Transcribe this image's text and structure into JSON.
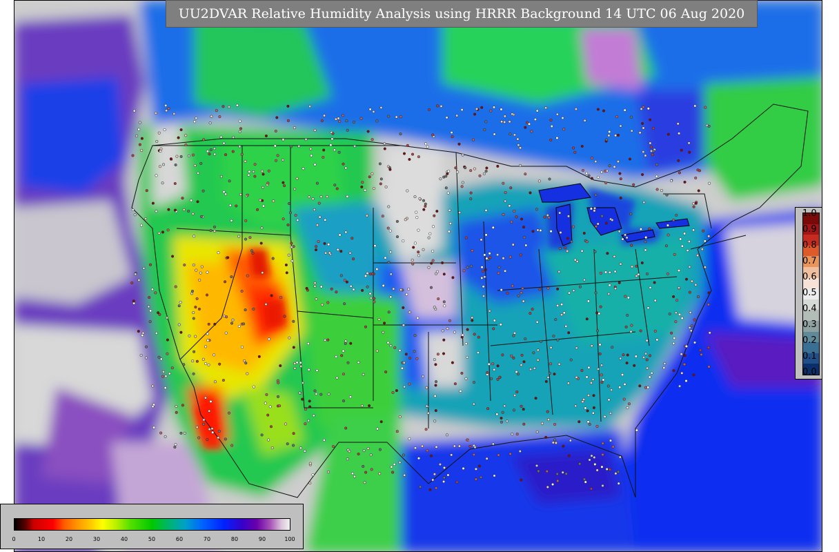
{
  "title": "UU2DVAR Relative Humidity Analysis using HRRR Background 14 UTC 06 Aug 2020",
  "rh_colorbar": {
    "ticks": [
      "0",
      "10",
      "20",
      "30",
      "40",
      "50",
      "60",
      "70",
      "80",
      "90",
      "100"
    ]
  },
  "increment_colorbar": {
    "ticks": [
      "1.0",
      "0.9",
      "0.8",
      "0.7",
      "0.6",
      "0.5",
      "0.4",
      "0.3",
      "0.2",
      "0.1",
      "0.0"
    ],
    "colors": [
      "#7a0a0a",
      "#a11616",
      "#c52b1e",
      "#de5a2a",
      "#e8945a",
      "#f0bfa0",
      "#f6e2d6",
      "#ececec",
      "#d6dad6",
      "#b2bdb8",
      "#8fa0a0",
      "#5f8a9a",
      "#3a6f94",
      "#1f4f86",
      "#0b2f6a"
    ]
  },
  "colors": {
    "ocean_blue": "#0a34f0",
    "deep_purple": "#5a10a8",
    "land_green": "#1fcf4a",
    "teal": "#14a6b0",
    "dry_yellow": "#f6e800",
    "dry_orange": "#ff9a00",
    "very_dry_red": "#ff1a00",
    "saturated_gray": "#d2d2d2",
    "title_bg": "#7f7f7f",
    "panel_bg": "#bfbfbf"
  }
}
